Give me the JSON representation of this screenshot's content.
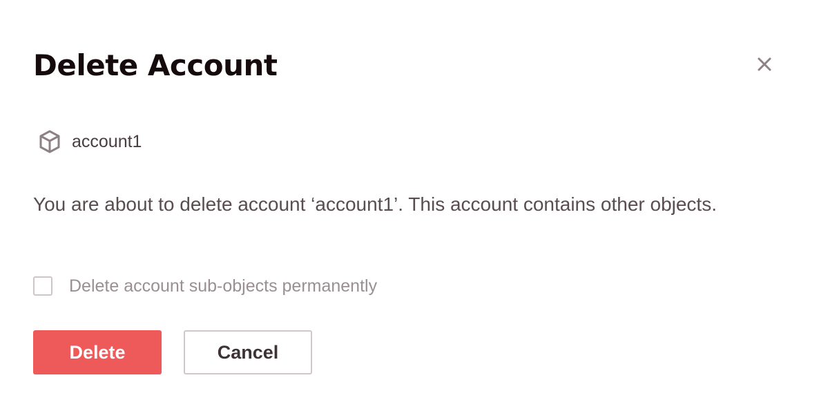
{
  "dialog": {
    "title": "Delete Account",
    "close_icon": "close-icon",
    "object": {
      "icon": "cube-icon",
      "name": "account1"
    },
    "message": "You are about to delete account ‘account1’. This account contains other objects.",
    "checkbox": {
      "label": "Delete account sub-objects permanently",
      "checked": false
    },
    "buttons": {
      "delete_label": "Delete",
      "cancel_label": "Cancel"
    }
  },
  "colors": {
    "danger": "#ee5a5a",
    "title_text": "#150b0c",
    "body_text": "#5a4d50",
    "muted_text": "#9a8f91",
    "border": "#cfc7c9"
  }
}
